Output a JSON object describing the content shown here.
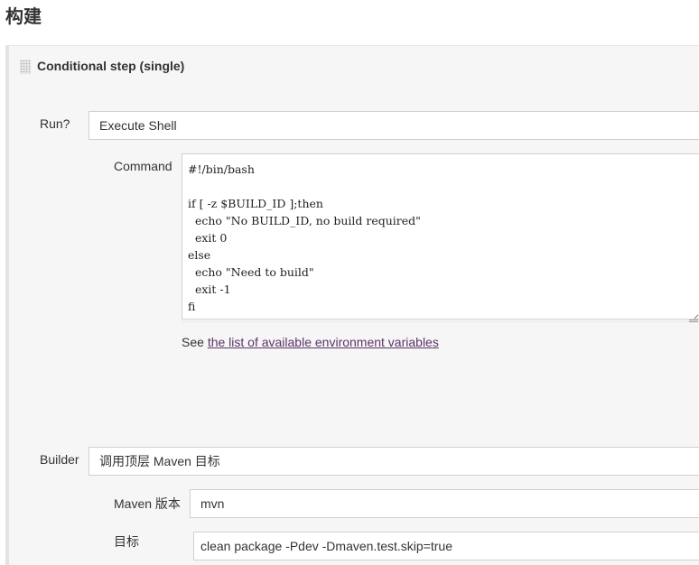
{
  "section_title": "构建",
  "step": {
    "title": "Conditional step (single)"
  },
  "run": {
    "label": "Run?",
    "value": "Execute Shell"
  },
  "command": {
    "label": "Command",
    "value": "#!/bin/bash\n\nif [ -z $BUILD_ID ];then\n  echo \"No BUILD_ID, no build required\"\n  exit 0\nelse\n  echo \"Need to build\"\n  exit -1\nfi"
  },
  "help": {
    "prefix": "See ",
    "link_text": "the list of available environment variables"
  },
  "builder": {
    "label": "Builder",
    "value": "调用顶层 Maven 目标"
  },
  "maven_version": {
    "label": "Maven 版本",
    "value": "mvn"
  },
  "goals": {
    "label": "目标",
    "value": "clean package -Pdev -Dmaven.test.skip=true"
  }
}
